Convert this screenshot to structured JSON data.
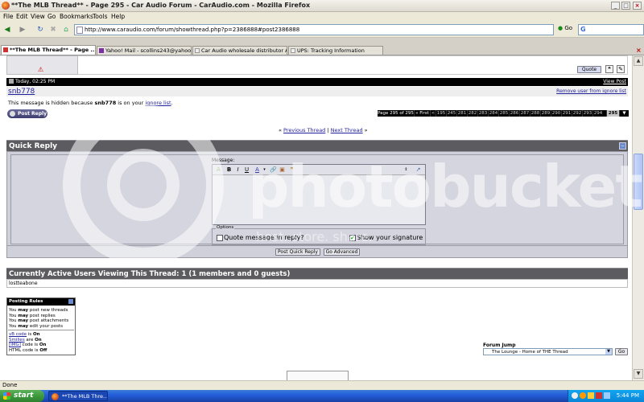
{
  "window": {
    "title": "**The MLB Thread** - Page 295 - Car Audio Forum - CarAudio.com - Mozilla Firefox",
    "controls": [
      "_",
      "□",
      "×"
    ]
  },
  "menu": [
    "File",
    "Edit",
    "View",
    "Go",
    "Bookmarks",
    "Tools",
    "Help"
  ],
  "nav": {
    "url": "http://www.caraudio.com/forum/showthread.php?p=2386888#post2386888",
    "go_label": "Go",
    "search_engine_icon": "google-g"
  },
  "tabs": [
    {
      "label": "**The MLB Thread** - Page ...",
      "active": true
    },
    {
      "label": "Yahoo! Mail - scollins243@yahoo.c...",
      "active": false
    },
    {
      "label": "Car Audio wholesale distributor Alpi...",
      "active": false
    },
    {
      "label": "UPS: Tracking Information",
      "active": false
    }
  ],
  "post": {
    "date": "Today, 02:25 PM",
    "view_post": "View Post",
    "username": "snb778",
    "remove_ignore": "Remove user from ignore list",
    "hidden_msg_prefix": "This message is hidden because ",
    "hidden_user": "snb778",
    "hidden_msg_mid": " is on your ",
    "ignore_list_link": "ignore list",
    "hidden_msg_suffix": ".",
    "quote_btn": "Quote",
    "post_reply_btn": "Post Reply"
  },
  "pagination": {
    "label": "Page 295 of 295",
    "first": "« First",
    "back": "<",
    "pages": [
      "195",
      "245",
      "281",
      "282",
      "283",
      "284",
      "285",
      "286",
      "287",
      "288",
      "289",
      "290",
      "291",
      "292",
      "293",
      "294",
      "295"
    ],
    "current": "295"
  },
  "thread_nav": {
    "prefix": "« ",
    "previous": "Previous Thread",
    "sep": " | ",
    "next": "Next Thread",
    "suffix": " »"
  },
  "quick_reply": {
    "title": "Quick Reply",
    "message_label": "Message:",
    "options_label": "Options",
    "quote_option": "Quote message in reply?",
    "quote_checked": false,
    "signature_option": "Show your signature",
    "signature_checked": true,
    "post_btn": "Post Quick Reply",
    "advanced_btn": "Go Advanced"
  },
  "active_users": {
    "title": "Currently Active Users Viewing This Thread: 1 (1 members and 0 guests)",
    "users": [
      "lostteabone"
    ]
  },
  "posting_rules": {
    "title": "Posting Rules",
    "lines": [
      {
        "pre": "You ",
        "bold": "may",
        "post": " post new threads"
      },
      {
        "pre": "You ",
        "bold": "may",
        "post": " post replies"
      },
      {
        "pre": "You ",
        "bold": "may",
        "post": " post attachments"
      },
      {
        "pre": "You ",
        "bold": "may",
        "post": " edit your posts"
      }
    ],
    "codes": [
      {
        "name": "vB code",
        "pre": " is ",
        "bold": "On"
      },
      {
        "name": "Smilies",
        "pre": " are ",
        "bold": "On"
      },
      {
        "name": "[IMG]",
        "pre": " code is ",
        "bold": "On"
      },
      {
        "name": "",
        "plain": "HTML code is ",
        "bold": "Off"
      }
    ]
  },
  "forum_jump": {
    "label": "Forum Jump",
    "selected": "The Lounge - Home of THE Thread",
    "go": "Go"
  },
  "status": "Done",
  "taskbar": {
    "start": "start",
    "item": "**The MLB Thre...",
    "clock": "5:44 PM"
  },
  "watermark": {
    "word": "photobucket",
    "tagline": "host. store. share."
  },
  "colors": {
    "header_gray": "#5c5c60",
    "panel_bg": "#cfd0da",
    "pagination_current": "#c8c8c8",
    "link": "#22229c",
    "xp_blue": "#245edb"
  }
}
